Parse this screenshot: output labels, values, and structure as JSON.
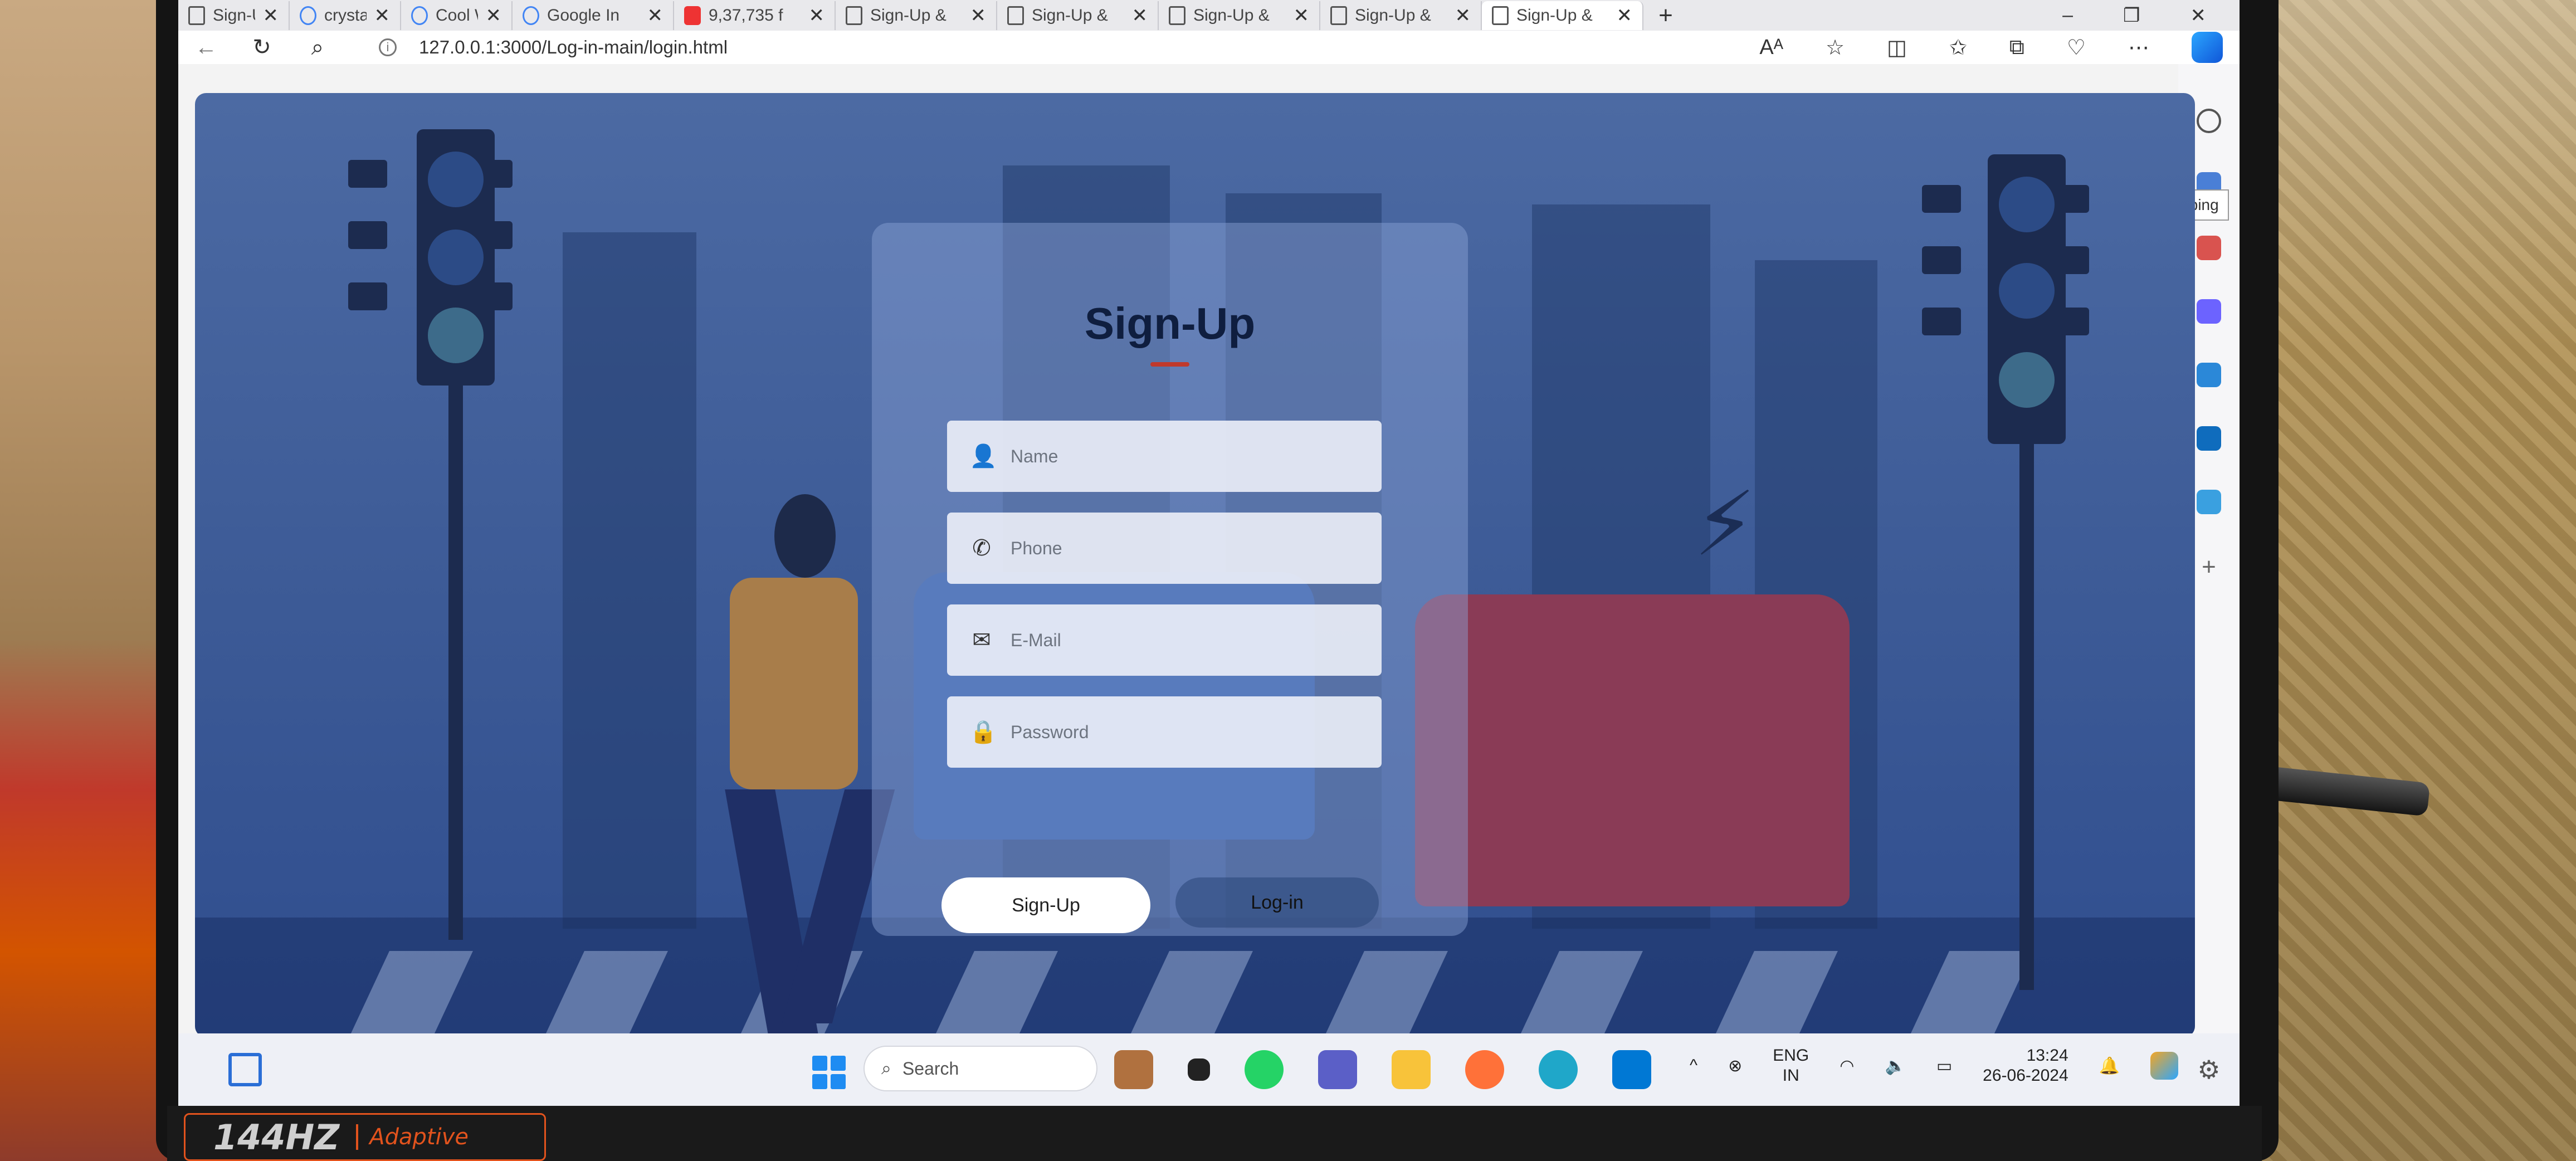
{
  "browser": {
    "tabs": [
      {
        "title": "Sign-Up",
        "icon": "page-icon"
      },
      {
        "title": "crystal h",
        "icon": "search-icon"
      },
      {
        "title": "Cool Wat",
        "icon": "search-icon"
      },
      {
        "title": "Google In",
        "icon": "google-icon"
      },
      {
        "title": "9,37,735 f",
        "icon": "app-icon"
      },
      {
        "title": "Sign-Up &",
        "icon": "page-icon"
      },
      {
        "title": "Sign-Up &",
        "icon": "page-icon"
      },
      {
        "title": "Sign-Up &",
        "icon": "page-icon"
      },
      {
        "title": "Sign-Up &",
        "icon": "page-icon"
      },
      {
        "title": "Sign-Up &",
        "icon": "page-icon",
        "active": true
      }
    ],
    "new_tab_label": "+",
    "window_controls": [
      "–",
      "❐",
      "✕"
    ],
    "url": "127.0.0.1:3000/Log-in-main/login.html",
    "tooltip": "Microsoft Shopping"
  },
  "form": {
    "title": "Sign-Up",
    "fields": [
      {
        "placeholder": "Name",
        "icon": "user-icon"
      },
      {
        "placeholder": "Phone",
        "icon": "phone-icon"
      },
      {
        "placeholder": "E-Mail",
        "icon": "mail-icon"
      },
      {
        "placeholder": "Password",
        "icon": "lock-icon"
      }
    ],
    "signup_button": "Sign-Up",
    "login_button": "Log-in"
  },
  "taskbar": {
    "search_placeholder": "Search",
    "language_line1": "ENG",
    "language_line2": "IN",
    "time": "13:24",
    "date": "26-06-2024"
  },
  "bezel": {
    "hz": "144HZ",
    "adaptive": "Adaptive"
  },
  "colors": {
    "page_bg": "#3c5a96",
    "accent_underline": "#c0392b",
    "windows_blue": "#1e8cf2"
  }
}
